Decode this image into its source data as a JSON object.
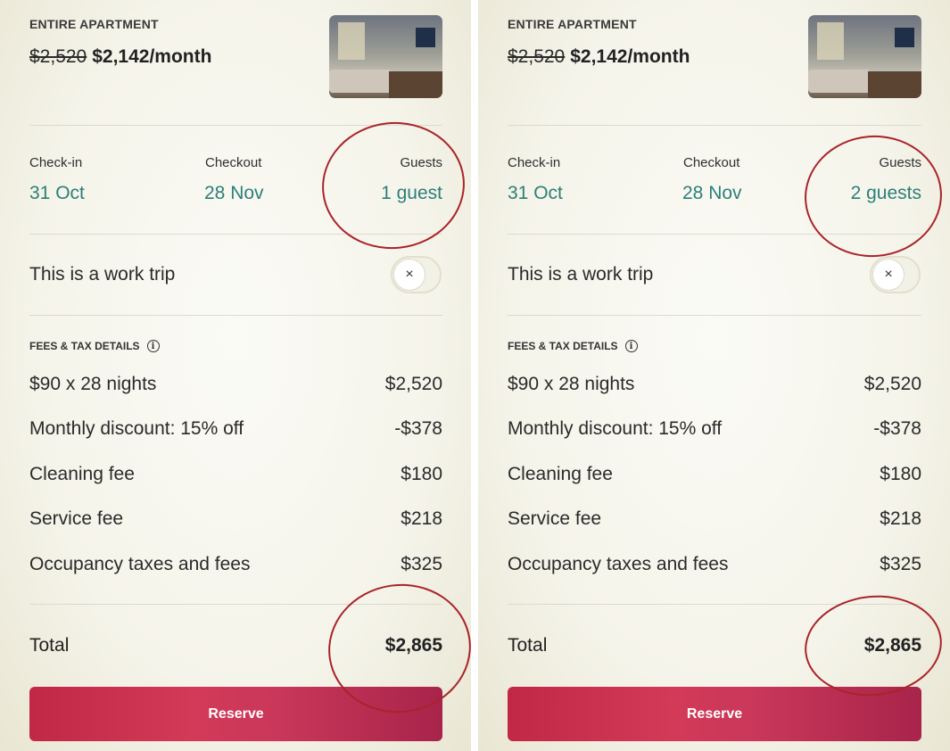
{
  "panels": [
    {
      "property_type": "ENTIRE APARTMENT",
      "price_old": "$2,520",
      "price_new": "$2,142/month",
      "checkin_label": "Check-in",
      "checkin_value": "31 Oct",
      "checkout_label": "Checkout",
      "checkout_value": "28 Nov",
      "guests_label": "Guests",
      "guests_value": "1 guest",
      "work_trip_label": "This is a work trip",
      "toggle_icon": "×",
      "toggle_on": false,
      "fees_header": "FEES & TAX DETAILS",
      "info_icon_glyph": "i",
      "fees": [
        {
          "label": "$90 x 28 nights",
          "amount": "$2,520"
        },
        {
          "label": "Monthly discount: 15% off",
          "amount": "-$378"
        },
        {
          "label": "Cleaning fee",
          "amount": "$180"
        },
        {
          "label": "Service fee",
          "amount": "$218"
        },
        {
          "label": "Occupancy taxes and fees",
          "amount": "$325"
        }
      ],
      "total_label": "Total",
      "total_amount": "$2,865",
      "reserve_label": "Reserve"
    },
    {
      "property_type": "ENTIRE APARTMENT",
      "price_old": "$2,520",
      "price_new": "$2,142/month",
      "checkin_label": "Check-in",
      "checkin_value": "31 Oct",
      "checkout_label": "Checkout",
      "checkout_value": "28 Nov",
      "guests_label": "Guests",
      "guests_value": "2 guests",
      "work_trip_label": "This is a work trip",
      "toggle_icon": "×",
      "toggle_on": false,
      "fees_header": "FEES & TAX DETAILS",
      "info_icon_glyph": "i",
      "fees": [
        {
          "label": "$90 x 28 nights",
          "amount": "$2,520"
        },
        {
          "label": "Monthly discount: 15% off",
          "amount": "-$378"
        },
        {
          "label": "Cleaning fee",
          "amount": "$180"
        },
        {
          "label": "Service fee",
          "amount": "$218"
        },
        {
          "label": "Occupancy taxes and fees",
          "amount": "$325"
        }
      ],
      "total_label": "Total",
      "total_amount": "$2,865",
      "reserve_label": "Reserve"
    }
  ],
  "colors": {
    "accent_teal": "#2c7f79",
    "reserve_red": "#c9375a",
    "annotation_circle": "#a9232a"
  }
}
